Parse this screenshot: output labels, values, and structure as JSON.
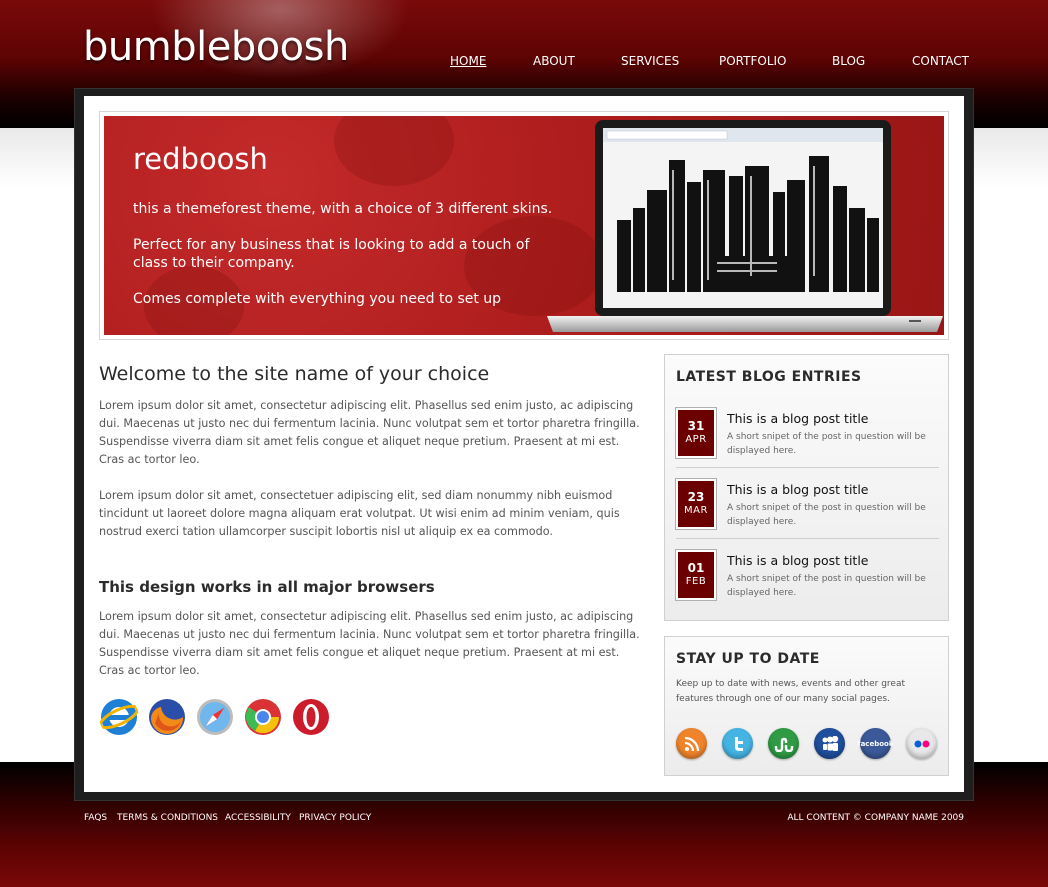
{
  "header": {
    "logo": "bumbleboosh",
    "nav": [
      {
        "label": "HOME",
        "active": true
      },
      {
        "label": "ABOUT",
        "active": false
      },
      {
        "label": "SERVICES",
        "active": false
      },
      {
        "label": "PORTFOLIO",
        "active": false
      },
      {
        "label": "BLOG",
        "active": false
      },
      {
        "label": "CONTACT",
        "active": false
      }
    ]
  },
  "banner": {
    "title": "redboosh",
    "line1": "this a themeforest theme, with a choice of 3 different skins.",
    "line2": "Perfect for any business that is looking to add a touch of class to their company.",
    "line3": "Comes complete with everything you need to set up"
  },
  "main": {
    "welcome_title": "Welcome to the site name of your choice",
    "para1": "Lorem ipsum dolor sit amet, consectetur adipiscing elit. Phasellus sed enim justo, ac adipiscing dui. Maecenas ut justo nec dui fermentum lacinia. Nunc volutpat sem et tortor pharetra fringilla. Suspendisse viverra diam sit amet felis congue et aliquet neque pretium. Praesent at mi est. Cras ac tortor leo.",
    "para2": "Lorem ipsum dolor sit amet, consectetuer adipiscing elit, sed diam nonummy nibh euismod tincidunt ut laoreet dolore magna aliquam erat volutpat. Ut wisi enim ad minim veniam, quis nostrud exerci tation ullamcorper suscipit lobortis nisl ut aliquip ex ea commodo.",
    "browsers_title": "This design works in all major browsers",
    "para3": "Lorem ipsum dolor sit amet, consectetur adipiscing elit. Phasellus sed enim justo, ac adipiscing dui. Maecenas ut justo nec dui fermentum lacinia. Nunc volutpat sem et tortor pharetra fringilla. Suspendisse viverra diam sit amet felis congue et aliquet neque pretium. Praesent at mi est. Cras ac tortor leo.",
    "browser_icons": [
      "internet-explorer-icon",
      "firefox-icon",
      "safari-icon",
      "chrome-icon",
      "opera-icon"
    ]
  },
  "sidebar": {
    "blog_title": "LATEST BLOG ENTRIES",
    "entries": [
      {
        "day": "31",
        "month": "APR",
        "title": "This is a blog post title",
        "snippet": "A short snipet of the post in question will be displayed here."
      },
      {
        "day": "23",
        "month": "MAR",
        "title": "This is a blog post title",
        "snippet": "A short snipet of the post in question will be displayed here."
      },
      {
        "day": "01",
        "month": "FEB",
        "title": "This is a blog post title",
        "snippet": "A short snipet of the post in question will be displayed here."
      }
    ],
    "stay_title": "STAY UP TO DATE",
    "stay_text": "Keep up to date with news, events and other great features through one of our many social pages.",
    "social": [
      {
        "icon": "rss-icon",
        "color": "#f0842b"
      },
      {
        "icon": "twitter-icon",
        "color": "#45b4e3"
      },
      {
        "icon": "stumbleupon-icon",
        "color": "#2f9b45"
      },
      {
        "icon": "myspace-icon",
        "color": "#1f4f9c"
      },
      {
        "icon": "facebook-icon",
        "label": "facebook",
        "color": "#3b5998"
      },
      {
        "icon": "flickr-icon",
        "color": "#e8e8e8"
      }
    ]
  },
  "footer": {
    "links": [
      "FAQS",
      "TERMS & CONDITIONS",
      "ACCESSIBILITY",
      "PRIVACY POLICY"
    ],
    "copyright": "ALL CONTENT © COMPANY NAME 2009"
  },
  "colors": {
    "brand_red": "#6a0000",
    "banner_red": "#b01e1e"
  }
}
